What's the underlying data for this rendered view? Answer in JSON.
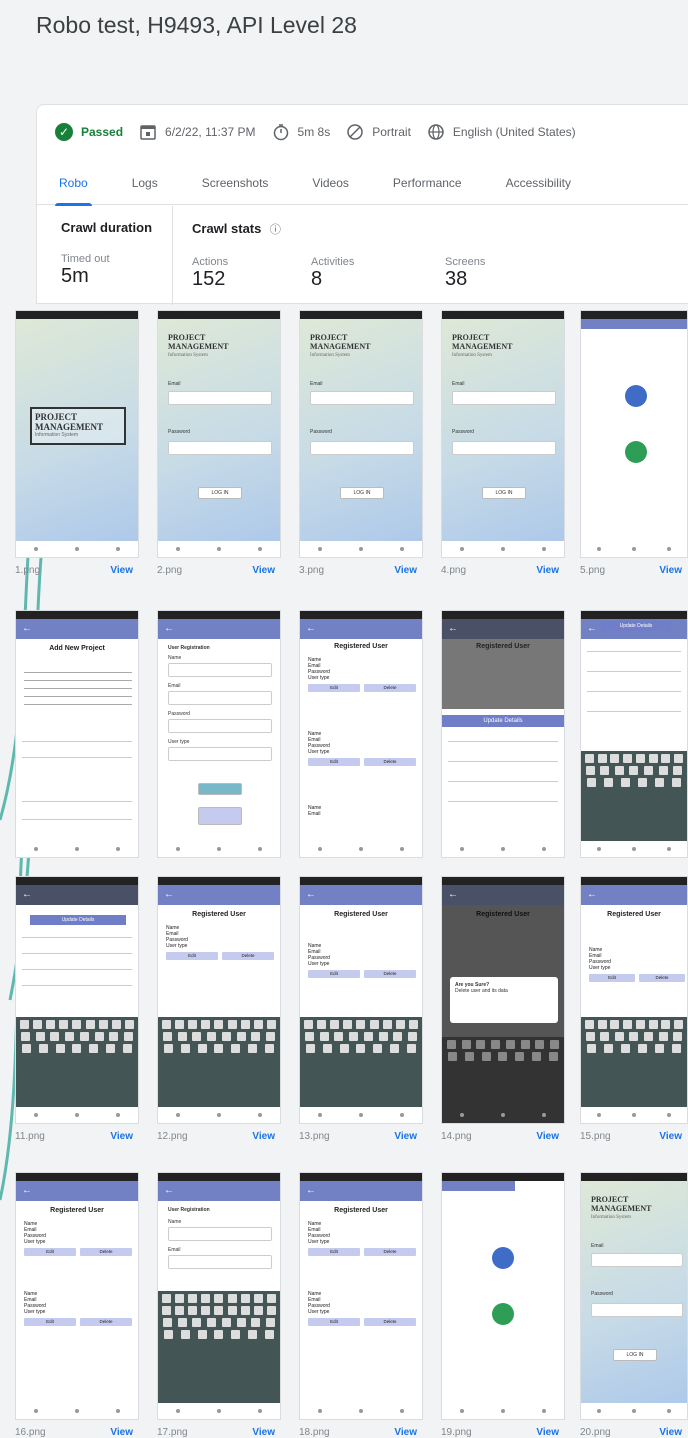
{
  "page": {
    "title": "Robo test, H9493, API Level 28"
  },
  "status": {
    "result": "Passed",
    "date": "6/2/22, 11:37 PM",
    "duration": "5m 8s",
    "orientation": "Portrait",
    "locale": "English (United States)"
  },
  "tabs": [
    "Robo",
    "Logs",
    "Screenshots",
    "Videos",
    "Performance",
    "Accessibility"
  ],
  "active_tab": "Robo",
  "stats": {
    "crawl_duration_label": "Crawl duration",
    "crawl_stats_label": "Crawl stats",
    "timed_out_label": "Timed out",
    "timed_out_value": "5m",
    "actions_label": "Actions",
    "actions_value": "152",
    "activities_label": "Activities",
    "activities_value": "8",
    "screens_label": "Screens",
    "screens_value": "38"
  },
  "view_label": "View",
  "screenshots": [
    {
      "file": "1.png"
    },
    {
      "file": "2.png"
    },
    {
      "file": "3.png"
    },
    {
      "file": "4.png"
    },
    {
      "file": "5.png"
    },
    {
      "file": ""
    },
    {
      "file": ""
    },
    {
      "file": ""
    },
    {
      "file": ""
    },
    {
      "file": ""
    },
    {
      "file": "11.png"
    },
    {
      "file": "12.png"
    },
    {
      "file": "13.png"
    },
    {
      "file": "14.png"
    },
    {
      "file": "15.png"
    },
    {
      "file": "16.png"
    },
    {
      "file": "17.png"
    },
    {
      "file": "18.png"
    },
    {
      "file": "19.png"
    },
    {
      "file": "20.png"
    }
  ],
  "app_text": {
    "brand_line1": "PROJECT",
    "brand_line2": "MANAGEMENT",
    "brand_sub": "Information System",
    "email": "Email",
    "password": "Password",
    "log_in": "LOG IN",
    "add_project": "Add New Project",
    "user_registration": "User Registration",
    "registered_user": "Registered User",
    "update_details": "Update Details",
    "name": "Name",
    "user_type": "User type",
    "edit": "Edit",
    "delete": "Delete",
    "save": "Save",
    "dialog_title": "Are you Sure?",
    "dialog_body": "Delete user and its data"
  },
  "colors": {
    "accent": "#1a73e8",
    "passed": "#188038",
    "app_bar": "#7280c4"
  }
}
